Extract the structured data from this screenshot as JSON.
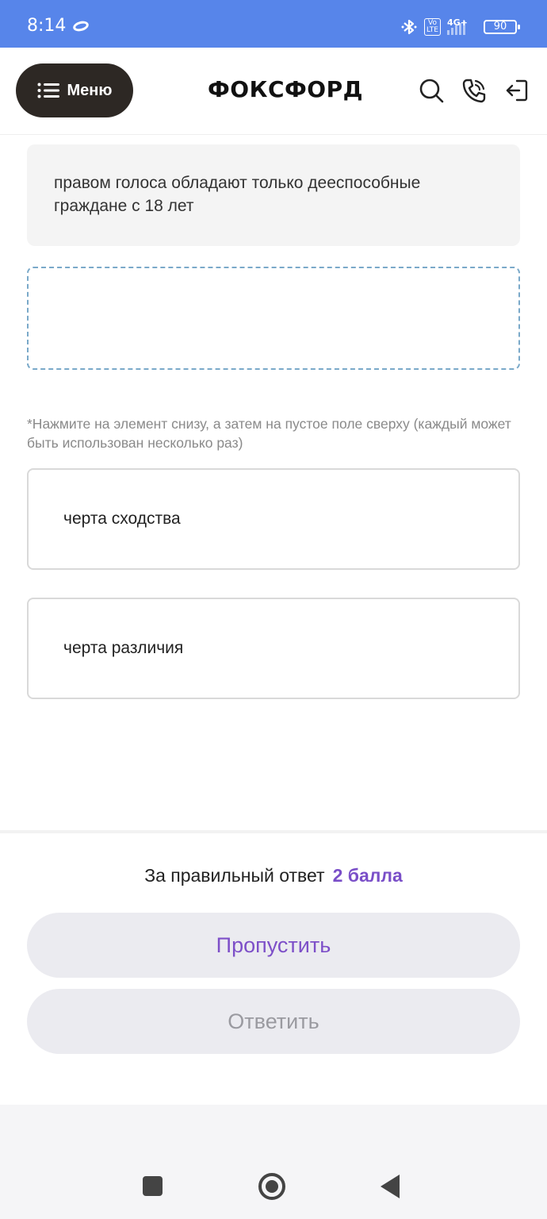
{
  "status_bar": {
    "time": "8:14",
    "volte": "Vo\nLTE",
    "network": "4G+",
    "battery": "90"
  },
  "header": {
    "menu_label": "Меню",
    "logo": "ФОКСФОРД"
  },
  "question": {
    "statement": "правом голоса обладают только дееспособные граждане с 18 лет",
    "hint": "*Нажмите на элемент снизу, а затем на пустое поле сверху (каждый может быть использован несколько раз)",
    "options": [
      {
        "label": "черта сходства"
      },
      {
        "label": "черта различия"
      }
    ]
  },
  "footer": {
    "points_text": "За правильный ответ",
    "points_value": "2 балла",
    "skip_label": "Пропустить",
    "answer_label": "Ответить"
  },
  "colors": {
    "status_bar": "#5785ea",
    "accent_purple": "#7a4fc8",
    "menu_button": "#2d2824",
    "drop_zone_border": "#7aa9c9"
  }
}
